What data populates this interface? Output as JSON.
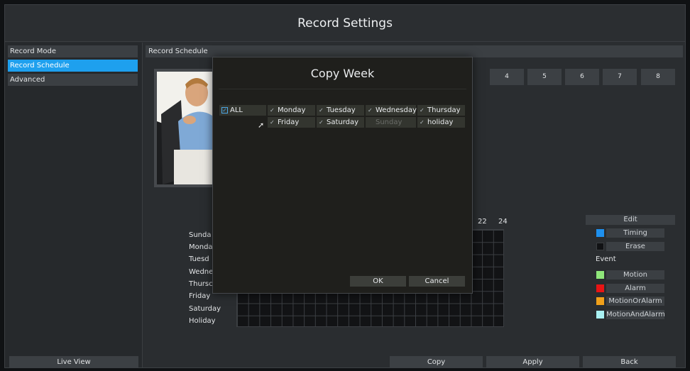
{
  "window": {
    "title": "Record Settings"
  },
  "sidebar": {
    "items": [
      {
        "label": "Record Mode",
        "active": false
      },
      {
        "label": "Record Schedule",
        "active": true
      },
      {
        "label": "Advanced",
        "active": false
      }
    ],
    "live_view_label": "Live View"
  },
  "main": {
    "header": "Record Schedule",
    "channels": [
      "4",
      "5",
      "6",
      "7",
      "8"
    ],
    "hour_labels": [
      "22",
      "24"
    ],
    "days": [
      "Sunda",
      "Monda",
      "Tuesd",
      "Wedne",
      "Thursc",
      "Friday",
      "Saturday",
      "Holiday"
    ]
  },
  "legend": {
    "edit_label": "Edit",
    "timing_label": "Timing",
    "erase_label": "Erase",
    "event_label": "Event",
    "motion_label": "Motion",
    "alarm_label": "Alarm",
    "motion_or_alarm_label": "MotionOrAlarm",
    "motion_and_alarm_label": "MotionAndAlarm",
    "colors": {
      "timing": "#1e90ee",
      "erase": "#111214",
      "motion": "#8fe67a",
      "alarm": "#e81414",
      "motion_or_alarm": "#f0a01a",
      "motion_and_alarm": "#a8f0f2"
    }
  },
  "bottom": {
    "copy_label": "Copy",
    "apply_label": "Apply",
    "back_label": "Back"
  },
  "modal": {
    "title": "Copy Week",
    "all_label": "ALL",
    "days": [
      {
        "label": "Monday",
        "checked": true,
        "enabled": true
      },
      {
        "label": "Tuesday",
        "checked": true,
        "enabled": true
      },
      {
        "label": "Wednesday",
        "checked": true,
        "enabled": true
      },
      {
        "label": "Thursday",
        "checked": true,
        "enabled": true
      },
      {
        "label": "Friday",
        "checked": true,
        "enabled": true
      },
      {
        "label": "Saturday",
        "checked": true,
        "enabled": true
      },
      {
        "label": "Sunday",
        "checked": false,
        "enabled": false
      },
      {
        "label": "holiday",
        "checked": true,
        "enabled": true
      }
    ],
    "ok_label": "OK",
    "cancel_label": "Cancel"
  }
}
